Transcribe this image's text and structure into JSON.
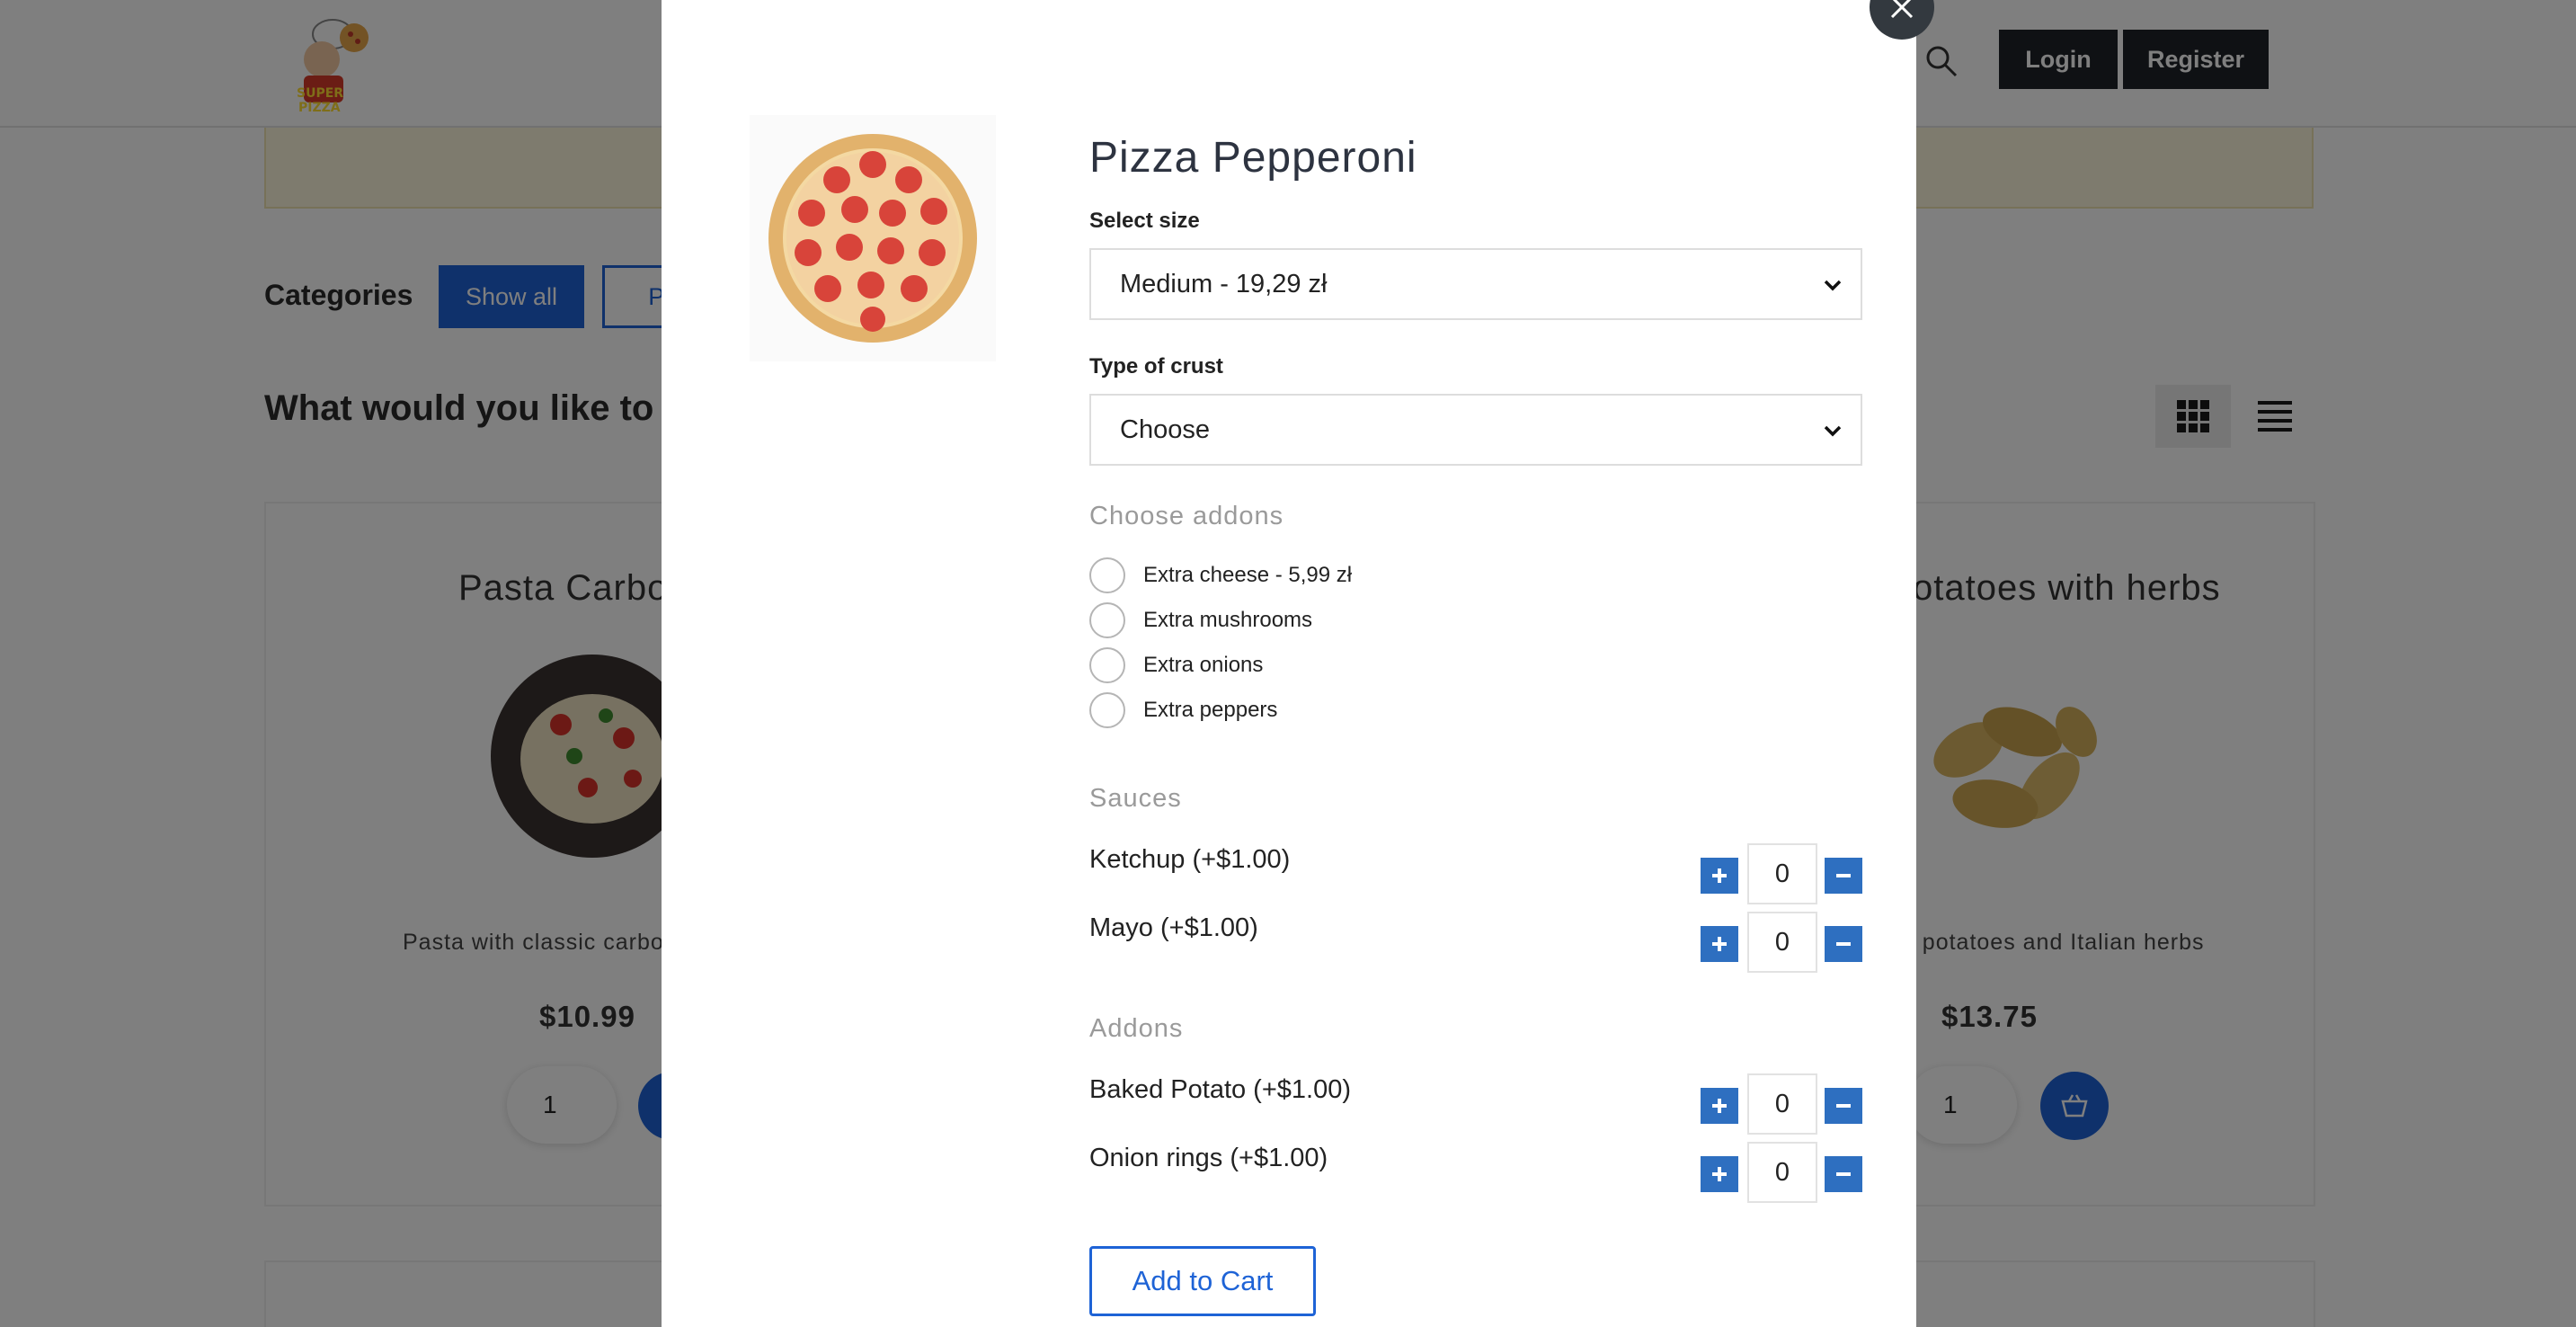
{
  "header": {
    "logo_alt": "Pizza restaurant logo",
    "login_label": "Login",
    "register_label": "Register"
  },
  "categories": {
    "label": "Categories",
    "show_all": "Show all",
    "pizza": "Piz"
  },
  "main": {
    "question": "What would you like to o"
  },
  "cards": [
    {
      "title": "Pasta Carbor",
      "description": "Pasta with classic carbo",
      "price": "$10.99",
      "qty": "1"
    },
    {
      "title": "otatoes with herbs",
      "description": "at potatoes and Italian herbs",
      "price": "$13.75",
      "qty": "1"
    }
  ],
  "modal": {
    "title": "Pizza Pepperoni",
    "size_label": "Select size",
    "size_value": "Medium - 19,29 zł",
    "crust_label": "Type of crust",
    "crust_value": "Choose",
    "addons_choose_label": "Choose addons",
    "radio_addons": [
      "Extra cheese - 5,99 zł",
      "Extra mushrooms",
      "Extra onions",
      "Extra peppers"
    ],
    "sauces_label": "Sauces",
    "sauces": [
      {
        "label": "Ketchup (+$1.00)",
        "qty": "0"
      },
      {
        "label": "Mayo (+$1.00)",
        "qty": "0"
      }
    ],
    "addons_label": "Addons",
    "addons": [
      {
        "label": "Baked Potato (+$1.00)",
        "qty": "0"
      },
      {
        "label": "Onion rings (+$1.00)",
        "qty": "0"
      }
    ],
    "add_to_cart": "Add to Cart"
  },
  "colors": {
    "accent": "#1e63d6",
    "stepper": "#2e6fc0",
    "dark_button": "#1f2328"
  }
}
